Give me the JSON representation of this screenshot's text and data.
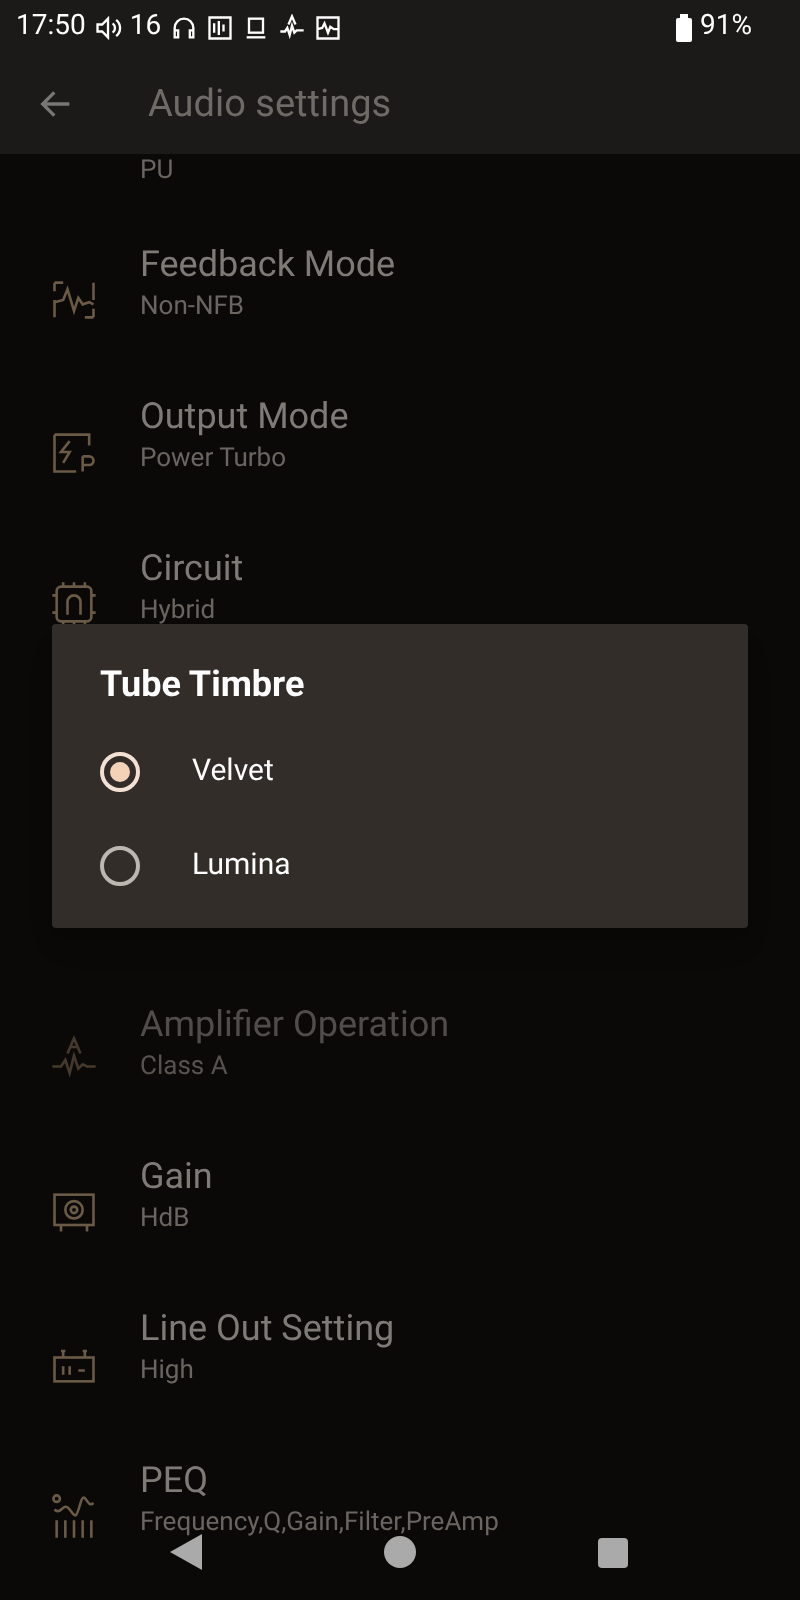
{
  "status_bar": {
    "time": "17:50",
    "volume": "16",
    "battery": "91%"
  },
  "app_bar": {
    "title": "Audio settings"
  },
  "settings_above_dialog": [
    {
      "subtitle": "PU",
      "disabled": false
    },
    {
      "title": "Feedback Mode",
      "subtitle": "Non-NFB",
      "disabled": false
    },
    {
      "title": "Output Mode",
      "subtitle": "Power Turbo",
      "disabled": false
    },
    {
      "title": "Circuit",
      "subtitle": "Hybrid",
      "disabled": false
    }
  ],
  "settings_below_dialog": [
    {
      "title": "Amplifier Operation",
      "subtitle": "Class A",
      "disabled": true
    },
    {
      "title": "Gain",
      "subtitle": "HdB",
      "disabled": false
    },
    {
      "title": "Line Out Setting",
      "subtitle": "High",
      "disabled": false
    },
    {
      "title": "PEQ",
      "subtitle": "Frequency,Q,Gain,Filter,PreAmp",
      "disabled": false
    }
  ],
  "dialog": {
    "title": "Tube Timbre",
    "options": [
      {
        "label": "Velvet",
        "selected": true
      },
      {
        "label": "Lumina",
        "selected": false
      }
    ]
  }
}
